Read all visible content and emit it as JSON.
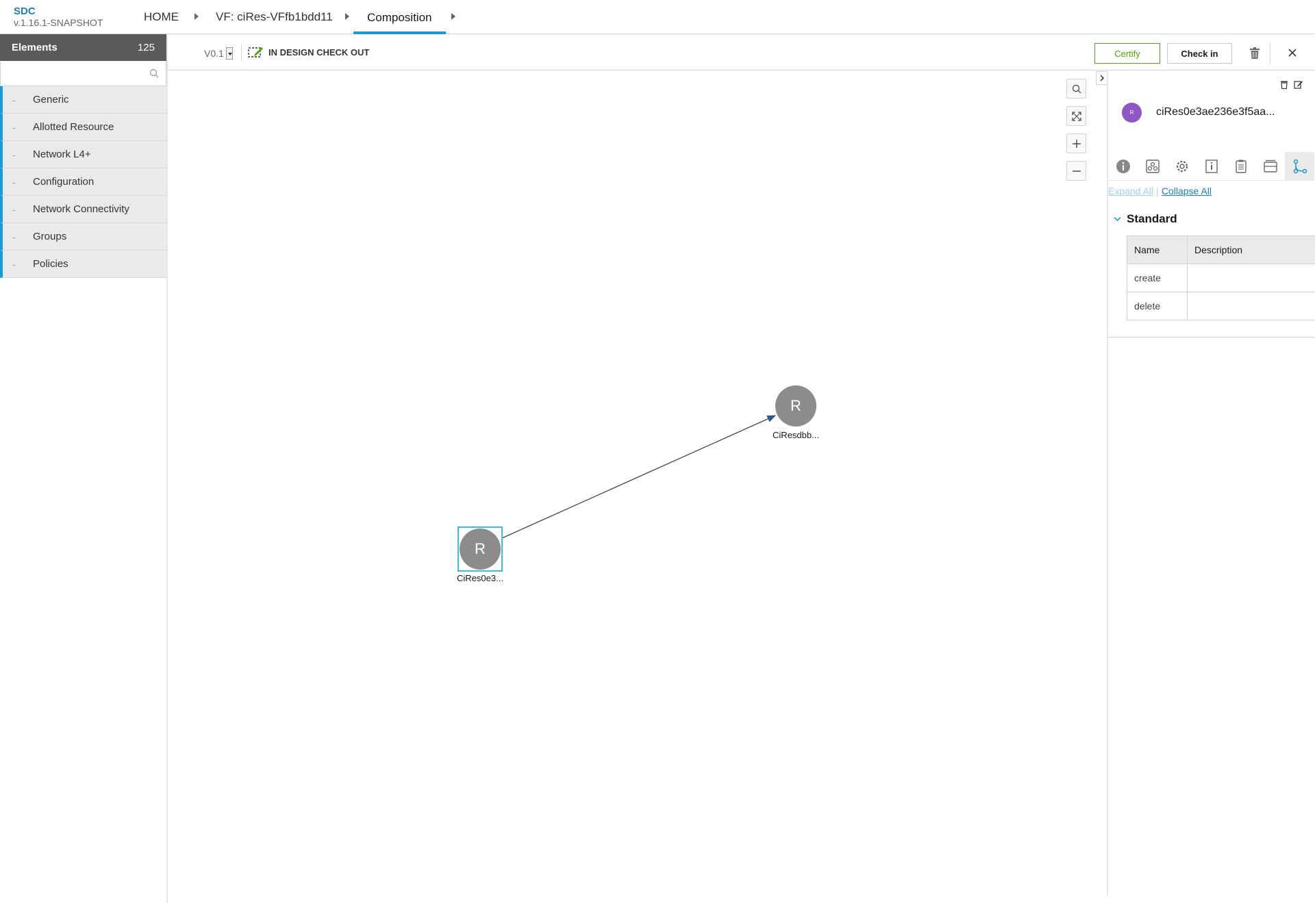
{
  "brand": {
    "app": "SDC",
    "version": "v.1.16.1-SNAPSHOT"
  },
  "nav": {
    "home": "HOME",
    "vf": "VF: ciRes-VFfb1bdd11",
    "composition": "Composition"
  },
  "left_panel": {
    "title": "Elements",
    "count": "125",
    "search_placeholder": "",
    "categories": [
      {
        "dash": "-",
        "label": "Generic"
      },
      {
        "dash": "-",
        "label": "Allotted Resource"
      },
      {
        "dash": "-",
        "label": "Network L4+"
      },
      {
        "dash": "-",
        "label": "Configuration"
      },
      {
        "dash": "-",
        "label": "Network Connectivity"
      },
      {
        "dash": "-",
        "label": "Groups"
      },
      {
        "dash": "-",
        "label": "Policies"
      }
    ]
  },
  "toolbar": {
    "version": "V0.1",
    "state": "IN DESIGN CHECK OUT",
    "certify_label": "Certify",
    "checkin_label": "Check in"
  },
  "canvas": {
    "nodes": [
      {
        "letter": "R",
        "label": "CiResdbb..."
      },
      {
        "letter": "R",
        "label": "CiRes0e3..."
      }
    ]
  },
  "right_panel": {
    "avatar_letter": "R",
    "title": "ciRes0e3ae236e3f5aa...",
    "expand_all": "Expand All",
    "collapse_all": "Collapse All",
    "section": "Standard",
    "table_headers": [
      "Name",
      "Description"
    ],
    "operations": [
      {
        "name": "create",
        "description": ""
      },
      {
        "name": "delete",
        "description": ""
      }
    ]
  },
  "colors": {
    "accent": "#1a9ad6",
    "certify": "#4ca90c",
    "avatar": "#8f56c4",
    "node": "#8c8c8c",
    "selection": "#3bbde9"
  }
}
